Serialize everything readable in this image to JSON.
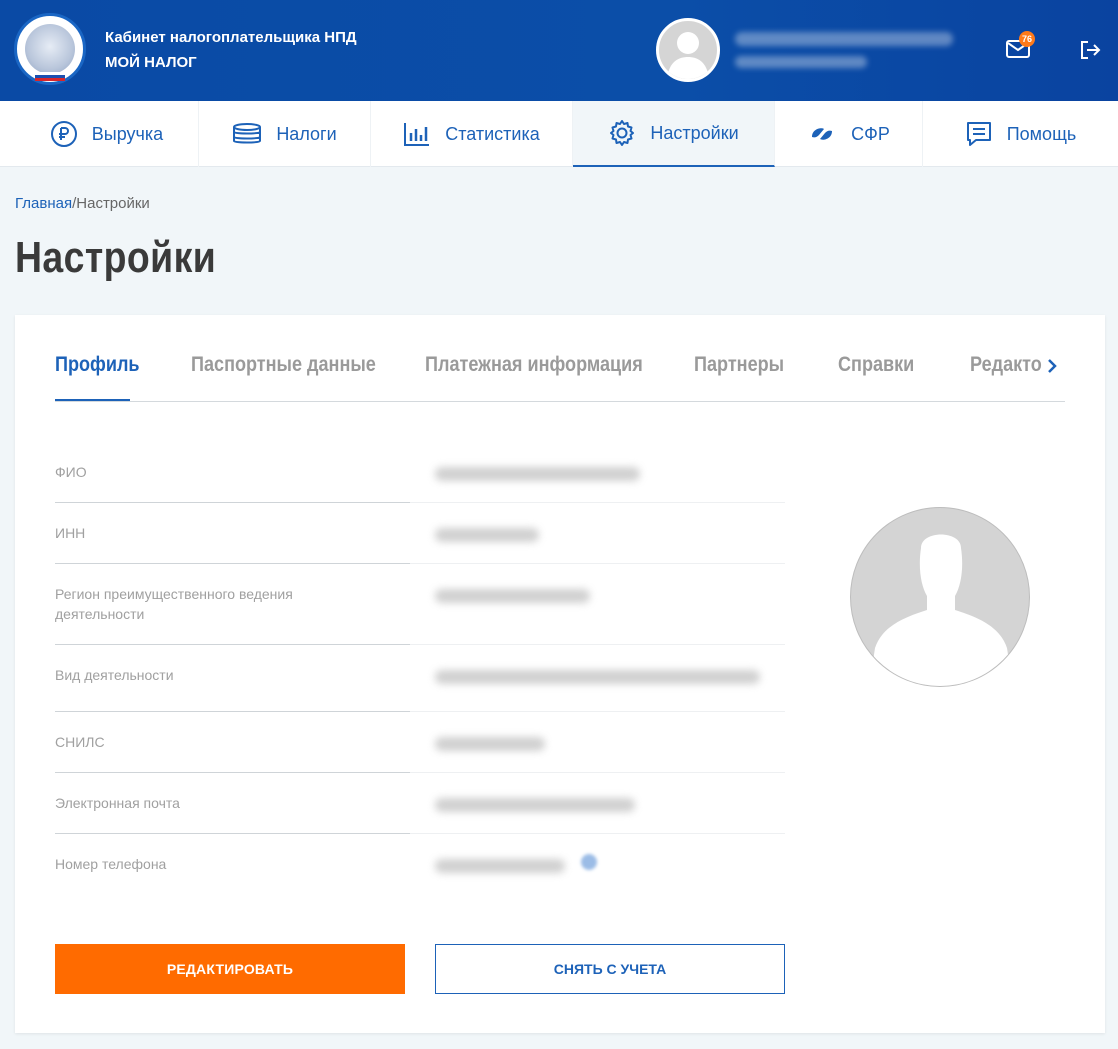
{
  "header": {
    "title": "Кабинет налогоплательщика НПД",
    "subtitle": "МОЙ НАЛОГ",
    "notifications_count": "76",
    "icons": [
      "emblem-logo",
      "avatar-icon",
      "mail-icon",
      "logout-icon"
    ]
  },
  "nav": {
    "items": [
      {
        "label": "Выручка",
        "icon": "ruble-icon"
      },
      {
        "label": "Налоги",
        "icon": "coins-icon"
      },
      {
        "label": "Статистика",
        "icon": "bar-chart-icon"
      },
      {
        "label": "Настройки",
        "icon": "gear-icon",
        "active": true
      },
      {
        "label": "СФР",
        "icon": "sfr-logo-icon"
      },
      {
        "label": "Помощь",
        "icon": "chat-icon"
      }
    ]
  },
  "breadcrumb": {
    "home": "Главная",
    "separator": "/",
    "current": "Настройки"
  },
  "page_title": "Настройки",
  "tabs": [
    {
      "label": "Профиль",
      "active": true
    },
    {
      "label": "Паспортные данные"
    },
    {
      "label": "Платежная информация"
    },
    {
      "label": "Партнеры"
    },
    {
      "label": "Справки"
    },
    {
      "label": "Редакто"
    }
  ],
  "profile": {
    "fields": [
      {
        "label": "ФИО"
      },
      {
        "label": "ИНН"
      },
      {
        "label": "Регион преимущественного ведения деятельности"
      },
      {
        "label": "Вид деятельности"
      },
      {
        "label": "СНИЛС"
      },
      {
        "label": "Электронная почта"
      },
      {
        "label": "Номер телефона"
      }
    ]
  },
  "actions": {
    "edit_label": "РЕДАКТИРОВАТЬ",
    "deregister_label": "СНЯТЬ С УЧЕТА"
  },
  "colors": {
    "header_bg": "#0b4ea8",
    "accent": "#1d62b8",
    "primary_button": "#ff6b00",
    "badge": "#ff7a1a"
  }
}
